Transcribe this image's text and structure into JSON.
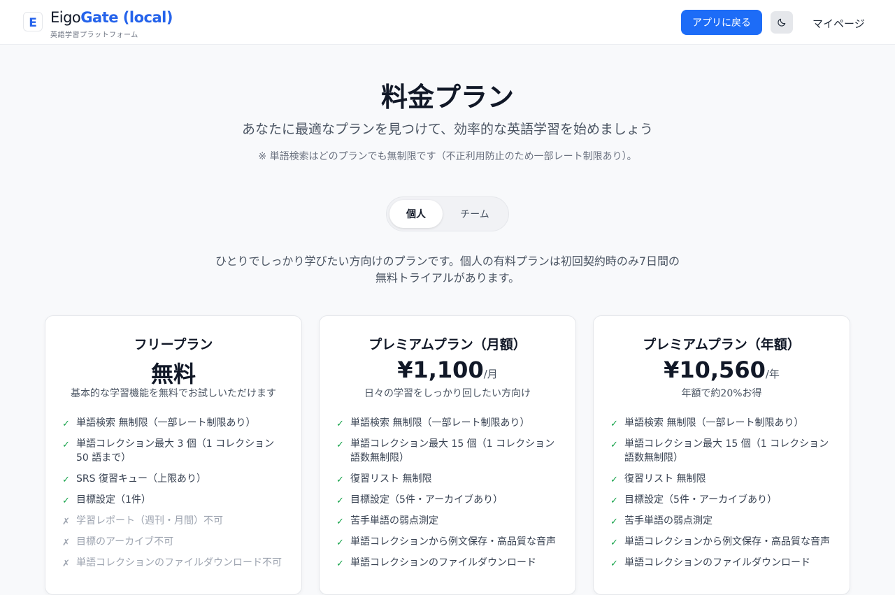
{
  "header": {
    "logo_letter": "E",
    "brand_part1": "Eigo",
    "brand_part2": "Gate (local)",
    "brand_sub": "英語学習プラットフォーム",
    "back_label": "アプリに戻る",
    "theme_icon": "moon-icon",
    "mypage_label": "マイページ"
  },
  "hero": {
    "title": "料金プラン",
    "subtitle": "あなたに最適なプランを見つけて、効率的な英語学習を始めましょう",
    "note": "※ 単語検索はどのプランでも無制限です（不正利用防止のため一部レート制限あり）。"
  },
  "toggle": {
    "options": [
      "個人",
      "チーム"
    ],
    "selected": "個人"
  },
  "description": "ひとりでしっかり学びたい方向けのプランです。個人の有料プランは初回契約時のみ7日間の無料トライアルがあります。",
  "plans": [
    {
      "title": "フリープラン",
      "price": "無料",
      "unit": "",
      "tagline": "基本的な学習機能を無料でお試しいただけます",
      "features": [
        {
          "text": "単語検索 無制限（一部レート制限あり）",
          "included": true
        },
        {
          "text": "単語コレクション最大 3 個（1 コレクション 50 語まで）",
          "included": true
        },
        {
          "text": "SRS 復習キュー（上限あり）",
          "included": true
        },
        {
          "text": "目標設定（1件）",
          "included": true
        },
        {
          "text": "学習レポート（週刊・月間）不可",
          "included": false
        },
        {
          "text": "目標のアーカイブ不可",
          "included": false
        },
        {
          "text": "単語コレクションのファイルダウンロード不可",
          "included": false
        }
      ]
    },
    {
      "title": "プレミアムプラン（月額）",
      "price": "¥1,100",
      "unit": "/月",
      "tagline": "日々の学習をしっかり回したい方向け",
      "features": [
        {
          "text": "単語検索 無制限（一部レート制限あり）",
          "included": true
        },
        {
          "text": "単語コレクション最大 15 個（1 コレクション語数無制限）",
          "included": true
        },
        {
          "text": "復習リスト 無制限",
          "included": true
        },
        {
          "text": "目標設定（5件・アーカイブあり）",
          "included": true
        },
        {
          "text": "苦手単語の弱点測定",
          "included": true
        },
        {
          "text": "単語コレクションから例文保存・高品質な音声",
          "included": true
        },
        {
          "text": "単語コレクションのファイルダウンロード",
          "included": true
        }
      ]
    },
    {
      "title": "プレミアムプラン（年額）",
      "price": "¥10,560",
      "unit": "/年",
      "tagline": "年額で約20%お得",
      "features": [
        {
          "text": "単語検索 無制限（一部レート制限あり）",
          "included": true
        },
        {
          "text": "単語コレクション最大 15 個（1 コレクション語数無制限）",
          "included": true
        },
        {
          "text": "復習リスト 無制限",
          "included": true
        },
        {
          "text": "目標設定（5件・アーカイブあり）",
          "included": true
        },
        {
          "text": "苦手単語の弱点測定",
          "included": true
        },
        {
          "text": "単語コレクションから例文保存・高品質な音声",
          "included": true
        },
        {
          "text": "単語コレクションのファイルダウンロード",
          "included": true
        }
      ]
    }
  ],
  "marks": {
    "check": "✓",
    "cross": "✗"
  },
  "colors": {
    "accent": "#1d6cf7",
    "check": "#16a34a",
    "disabled": "#9ca3af"
  }
}
